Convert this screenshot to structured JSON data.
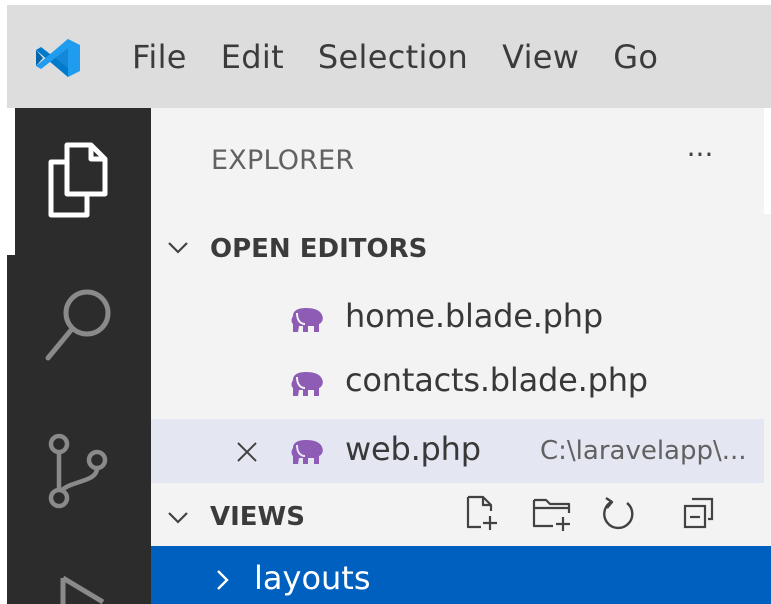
{
  "menubar": {
    "logo": "vscode-logo-icon",
    "items": [
      "File",
      "Edit",
      "Selection",
      "View",
      "Go"
    ]
  },
  "activitybar": {
    "icons": [
      "files-icon",
      "search-icon",
      "source-control-icon",
      "run-debug-icon"
    ]
  },
  "explorer": {
    "title": "EXPLORER",
    "more": "···"
  },
  "open_editors": {
    "header": "OPEN EDITORS",
    "files": [
      {
        "name": "home.blade.php",
        "path": ""
      },
      {
        "name": "contacts.blade.php",
        "path": ""
      },
      {
        "name": "web.php",
        "path": "C:\\laravelapp\\..."
      }
    ]
  },
  "views": {
    "header": "VIEWS",
    "toolbar": [
      "new-file-icon",
      "new-folder-icon",
      "refresh-icon",
      "collapse-all-icon"
    ],
    "items": [
      {
        "label": "layouts",
        "selected": true
      }
    ]
  },
  "colors": {
    "activitybar": "#2c2c2c",
    "sidebar": "#f3f3f3",
    "menubar": "#dddddd",
    "selection": "#0060c0",
    "php_icon": "#8e5bb5"
  }
}
